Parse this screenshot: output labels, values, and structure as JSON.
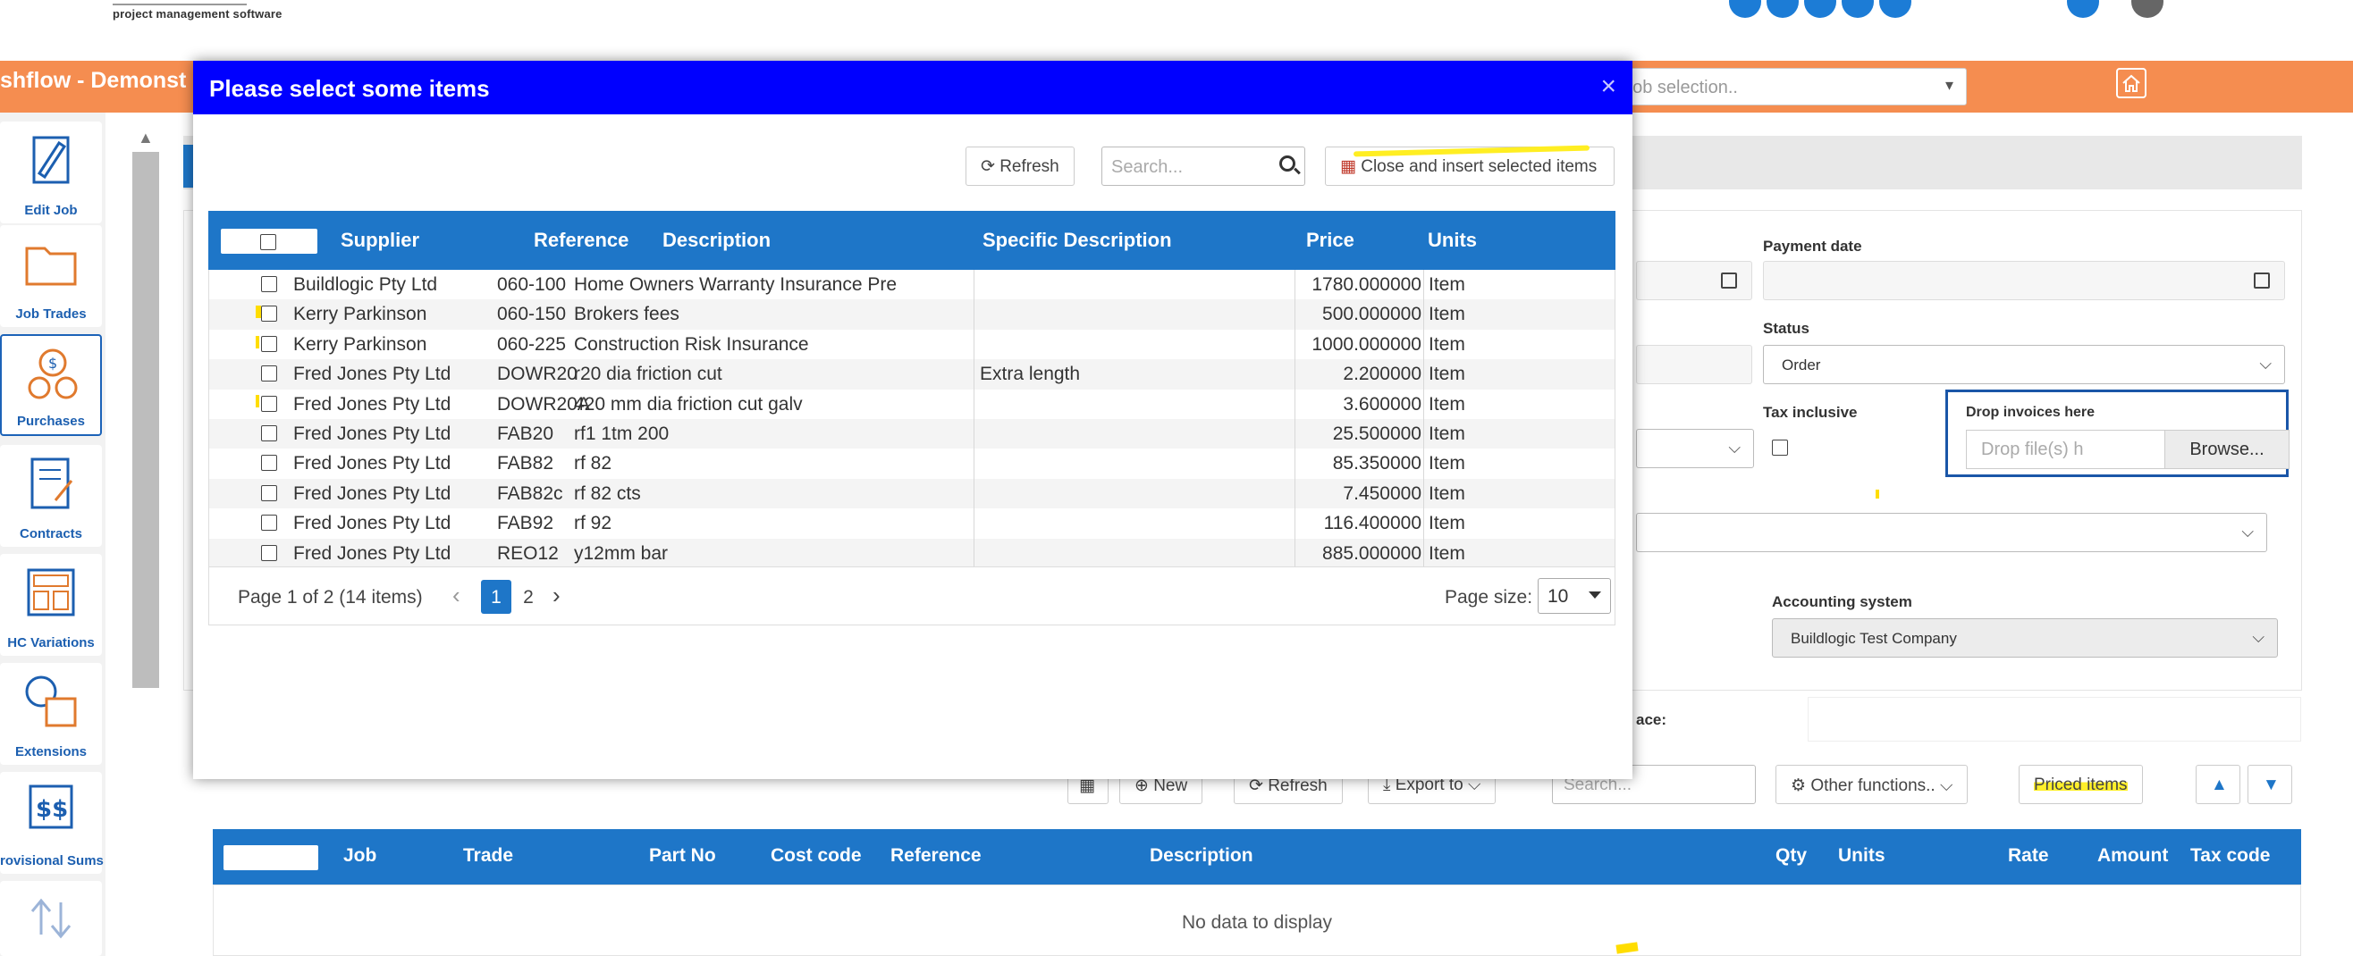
{
  "header": {
    "logo_tagline": "project management software"
  },
  "appbar": {
    "title": "shflow - Demonst",
    "job_select_placeholder": "e job selection.."
  },
  "sidebar": {
    "items": [
      {
        "label": "Edit Job",
        "icon": "edit-job-icon"
      },
      {
        "label": "Job Trades",
        "icon": "folder-icon"
      },
      {
        "label": "Purchases",
        "icon": "coins-icon"
      },
      {
        "label": "Contracts",
        "icon": "contract-icon"
      },
      {
        "label": "HC Variations",
        "icon": "calculator-icon"
      },
      {
        "label": "Extensions",
        "icon": "calendar-clock-icon"
      },
      {
        "label": "rovisional Sums",
        "icon": "dollar-sums-icon"
      }
    ]
  },
  "background_form": {
    "payment_date_label": "Payment date",
    "status_label": "Status",
    "status_value": "Order",
    "tax_inclusive_label": "Tax inclusive",
    "drop_invoices_label": "Drop invoices here",
    "drop_placeholder": "Drop file(s) h",
    "browse_label": "Browse...",
    "accounting_label": "Accounting system",
    "accounting_value": "Buildlogic Test Company",
    "partial_label": "ace:"
  },
  "background_toolbar": {
    "new_label": "New",
    "refresh_label": "Refresh",
    "export_label": "Export to",
    "search_placeholder": "Search...",
    "other_functions_label": "Other functions..",
    "priced_items_label": "Priced items"
  },
  "background_grid": {
    "columns": [
      "Job",
      "Trade",
      "Part No",
      "Cost code",
      "Reference",
      "Description",
      "Qty",
      "Units",
      "Rate",
      "Amount",
      "Tax code"
    ],
    "empty_text": "No data to display"
  },
  "modal": {
    "title": "Please select some items",
    "close_symbol": "×",
    "refresh_label": "Refresh",
    "search_placeholder": "Search...",
    "insert_label": "Close and insert selected items",
    "columns": {
      "supplier": "Supplier",
      "reference": "Reference",
      "description": "Description",
      "specific": "Specific Description",
      "price": "Price",
      "units": "Units"
    },
    "rows": [
      {
        "supplier": "Buildlogic Pty Ltd",
        "reference": "060-100",
        "description": "Home Owners Warranty Insurance Pre",
        "specific": "",
        "price": "1780.000000",
        "units": "Item"
      },
      {
        "supplier": "Kerry Parkinson",
        "reference": "060-150",
        "description": "Brokers fees",
        "specific": "",
        "price": "500.000000",
        "units": "Item"
      },
      {
        "supplier": "Kerry Parkinson",
        "reference": "060-225",
        "description": "Construction Risk Insurance",
        "specific": "",
        "price": "1000.000000",
        "units": "Item"
      },
      {
        "supplier": "Fred Jones Pty Ltd",
        "reference": "DOWR20",
        "description": "r20 dia friction cut",
        "specific": "Extra length",
        "price": "2.200000",
        "units": "Item"
      },
      {
        "supplier": "Fred Jones Pty Ltd",
        "reference": "DOWR20A",
        "description": "420 mm dia friction cut galv",
        "specific": "",
        "price": "3.600000",
        "units": "Item"
      },
      {
        "supplier": "Fred Jones Pty Ltd",
        "reference": "FAB20",
        "description": "rf1 1tm 200",
        "specific": "",
        "price": "25.500000",
        "units": "Item"
      },
      {
        "supplier": "Fred Jones Pty Ltd",
        "reference": "FAB82",
        "description": "rf 82",
        "specific": "",
        "price": "85.350000",
        "units": "Item"
      },
      {
        "supplier": "Fred Jones Pty Ltd",
        "reference": "FAB82c",
        "description": "rf 82 cts",
        "specific": "",
        "price": "7.450000",
        "units": "Item"
      },
      {
        "supplier": "Fred Jones Pty Ltd",
        "reference": "FAB92",
        "description": "rf 92",
        "specific": "",
        "price": "116.400000",
        "units": "Item"
      },
      {
        "supplier": "Fred Jones Pty Ltd",
        "reference": "REO12",
        "description": "y12mm bar",
        "specific": "",
        "price": "885.000000",
        "units": "Item"
      }
    ],
    "pager": {
      "info": "Page 1 of 2 (14 items)",
      "pages": [
        "1",
        "2"
      ],
      "page_size_label": "Page size:",
      "page_size": "10"
    }
  },
  "colors": {
    "modal_header": "#0000ff",
    "grid_header": "#1e76c8",
    "app_bar": "#f58d50",
    "highlight": "#ffee22"
  }
}
